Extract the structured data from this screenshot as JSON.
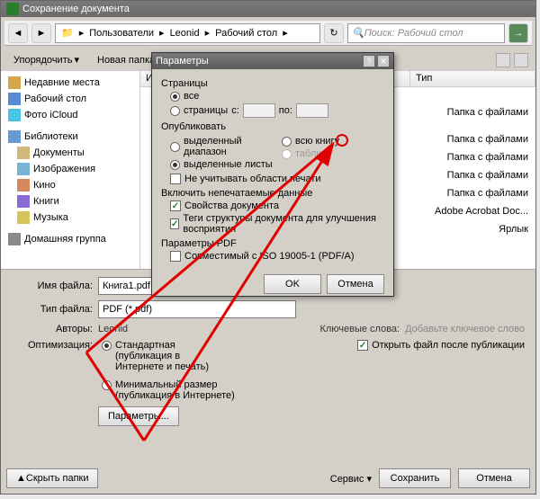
{
  "window": {
    "title": "Сохранение документа"
  },
  "nav": {
    "breadcrumb": [
      "Пользователи",
      "Leonid",
      "Рабочий стол"
    ],
    "search_placeholder": "Поиск: Рабочий стол"
  },
  "toolbar": {
    "organize": "Упорядочить",
    "new_folder": "Новая папка"
  },
  "sidebar": {
    "recent": "Недавние места",
    "desktop": "Рабочий стол",
    "icloud": "Фото iCloud",
    "libraries_heading": "Библиотеки",
    "documents": "Документы",
    "images": "Изображения",
    "movies": "Кино",
    "books": "Книги",
    "music": "Музыка",
    "homegroup": "Домашняя группа"
  },
  "filelist": {
    "col_name": "И",
    "col_type": "Тип",
    "types": [
      "Папка с файлами",
      "Папка с файлами",
      "Папка с файлами",
      "Папка с файлами",
      "Папка с файлами",
      "Adobe Acrobat Doc...",
      "Ярлык"
    ]
  },
  "form": {
    "filename_label": "Имя файла:",
    "filename_value": "Книга1.pdf",
    "filetype_label": "Тип файла:",
    "filetype_value": "PDF (*.pdf)",
    "authors_label": "Авторы:",
    "authors_value": "Leonid",
    "keywords_label": "Ключевые слова:",
    "keywords_value": "Добавьте ключевое слово",
    "optimization_label": "Оптимизация:",
    "opt_standard": "Стандартная (публикация в Интернете и печать)",
    "opt_minimal": "Минимальный размер (публикация в Интернете)",
    "open_after": "Открыть файл после публикации",
    "params_btn": "Параметры..."
  },
  "footer": {
    "hide_folders": "Скрыть папки",
    "tools": "Сервис",
    "save": "Сохранить",
    "cancel": "Отмена"
  },
  "params": {
    "title": "Параметры",
    "pages_label": "Страницы",
    "all": "все",
    "pages": "страницы",
    "from": "с:",
    "to": "по:",
    "publish_label": "Опубликовать",
    "sel_range": "выделенный диапазон",
    "sel_sheets": "выделенные листы",
    "whole_book": "всю книгу",
    "table": "таблицу",
    "ignore_print": "Не учитывать области печати",
    "include_label": "Включить непечатаемые данные",
    "doc_props": "Свойства документа",
    "tags": "Теги структуры документа для улучшения восприятия",
    "pdf_params_label": "Параметры PDF",
    "iso": "Совместимый с ISO 19005-1 (PDF/A)",
    "ok": "OK",
    "cancel": "Отмена"
  }
}
